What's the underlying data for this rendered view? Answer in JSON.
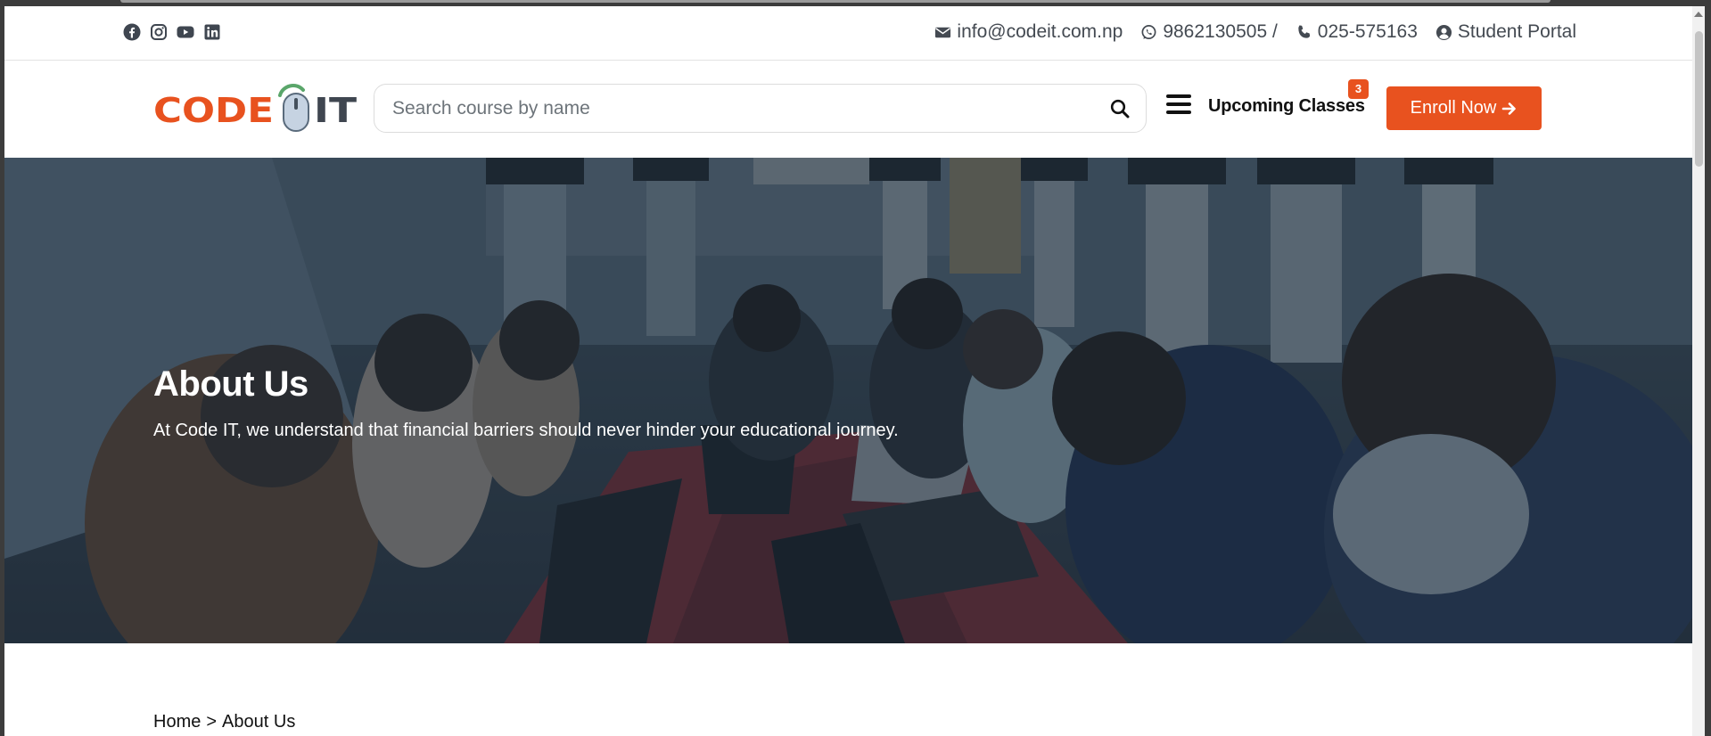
{
  "topbar": {
    "social": [
      "facebook-icon",
      "instagram-icon",
      "youtube-icon",
      "linkedin-icon"
    ],
    "email": "info@codeit.com.np",
    "whatsapp": "9862130505 /",
    "phone": "025-575163",
    "portal": "Student Portal"
  },
  "header": {
    "logo_left": "CODE",
    "logo_right": "IT",
    "search_placeholder": "Search course by name",
    "upcoming_label": "Upcoming Classes",
    "upcoming_count": "3",
    "enroll_label": "Enroll Now"
  },
  "hero": {
    "title": "About Us",
    "subtitle": "At Code IT, we understand that financial barriers should never hinder your educational journey."
  },
  "breadcrumb": {
    "home": "Home",
    "separator": ">",
    "current": "About Us"
  },
  "colors": {
    "accent": "#e8521f",
    "logo_green": "#5aa66a",
    "text_dark": "#111111"
  }
}
